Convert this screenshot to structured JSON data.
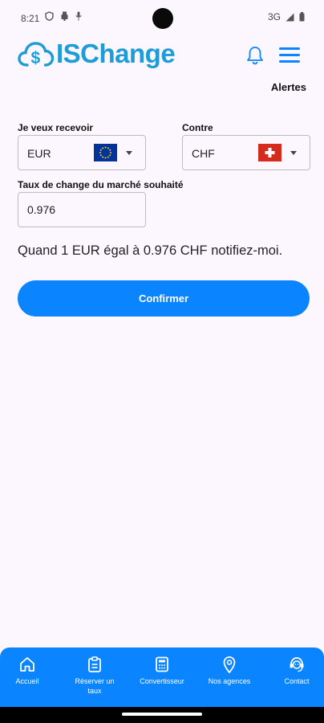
{
  "status_bar": {
    "time": "8:21",
    "network": "3G",
    "icons": [
      "shield-icon",
      "usb-icon",
      "mic-icon",
      "signal-icon",
      "battery-icon"
    ]
  },
  "header": {
    "logo_text": "ISChange",
    "logo_color": "#1E9CD7",
    "icons": [
      "bell-icon",
      "menu-icon"
    ]
  },
  "page": {
    "title_link": "Alertes"
  },
  "form": {
    "receive": {
      "label": "Je veux recevoir",
      "value": "EUR",
      "flag": "eu-flag-icon"
    },
    "against": {
      "label": "Contre",
      "value": "CHF",
      "flag": "swiss-flag-icon"
    },
    "rate": {
      "label": "Taux de change du marché souhaité",
      "value": "0.976"
    },
    "summary": "Quand 1 EUR égal à 0.976 CHF notifiez-moi.",
    "confirm_label": "Confirmer"
  },
  "bottom_nav": {
    "color": "#0A84FF",
    "items": [
      {
        "label": "Accueil",
        "icon": "home-icon"
      },
      {
        "label": "Réserver un taux",
        "icon": "clipboard-icon"
      },
      {
        "label": "Convertisseur",
        "icon": "calculator-icon"
      },
      {
        "label": "Nos agences",
        "icon": "location-pin-icon"
      },
      {
        "label": "Contact",
        "icon": "support-agent-icon"
      }
    ]
  }
}
